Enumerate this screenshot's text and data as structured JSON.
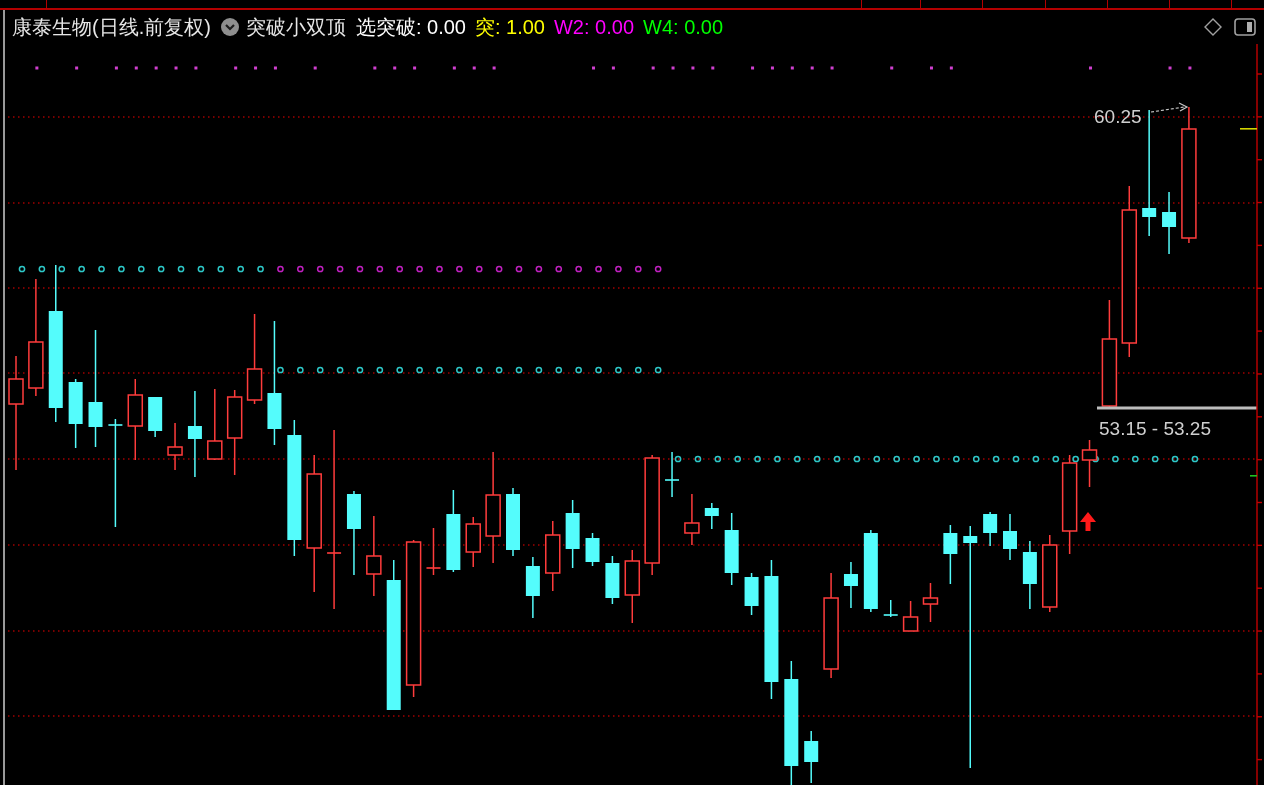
{
  "header": {
    "title": "康泰生物(日线.前复权)",
    "indicator": "突破小双顶",
    "readouts": [
      {
        "text": "选突破: 0.00",
        "color": "#ffffff"
      },
      {
        "text": "突: 1.00",
        "color": "#ffff00"
      },
      {
        "text": "W2: 0.00",
        "color": "#ff00ff"
      },
      {
        "text": "W4: 0.00",
        "color": "#00ff00"
      }
    ]
  },
  "chart": {
    "high_label": "60.25",
    "range_label": "53.15 - 53.25"
  }
}
